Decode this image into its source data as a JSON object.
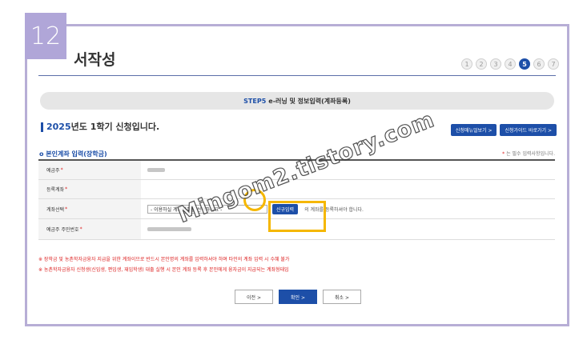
{
  "step_badge": "12",
  "page_title": "서작성",
  "progress": {
    "steps": [
      "1",
      "2",
      "3",
      "4",
      "5",
      "6",
      "7"
    ],
    "current_index": 4
  },
  "step_bar": {
    "prefix": "STEP5",
    "text": "e-러닝 및 정보입력(계좌등록)"
  },
  "semester": {
    "year": "2025",
    "text": "년도 1학기 신청입니다."
  },
  "top_buttons": {
    "manual": "신청매뉴얼보기 >",
    "guide": "신청가이드 바로가기 >"
  },
  "section_title": "본인계좌 입력(장학금)",
  "required_note": {
    "star": "*",
    "text": " 는 필수 입력사항입니다."
  },
  "form": {
    "rows": [
      {
        "label": "예금주",
        "required": "*"
      },
      {
        "label": "등록계좌",
        "required": "*"
      },
      {
        "label": "계좌선택",
        "required": "*"
      },
      {
        "label": "예금주 주민번호",
        "required": "*"
      }
    ],
    "account_select_value": "- 이용하실 계좌번호를 선택하세요 -",
    "new_entry_button": "신규입력",
    "new_entry_guide": "의 계좌를 등록하셔야 합니다."
  },
  "notes": [
    "※ 장학금 및 농촌학자금융자 지급을 위한 계좌이므로 반드시 본인명의 계좌를 입력하셔야 하며 타인의 계좌 입력 시 수혜 불가",
    "※ 농촌학자금융자 신청생(신입생, 편입생, 재입학생) 대출 실행 시 본인 계좌 등록 후 본인에게 융자금이 지급되는 계좌형태임"
  ],
  "bottom_buttons": {
    "prev": "이전  >",
    "confirm": "확인  >",
    "cancel": "취소  >"
  },
  "watermark": "Mingom2.tistory.com",
  "colors": {
    "accent": "#1d4fa8",
    "frame": "#b7aed6",
    "highlight": "#f5b700",
    "note_red": "#d22222"
  }
}
